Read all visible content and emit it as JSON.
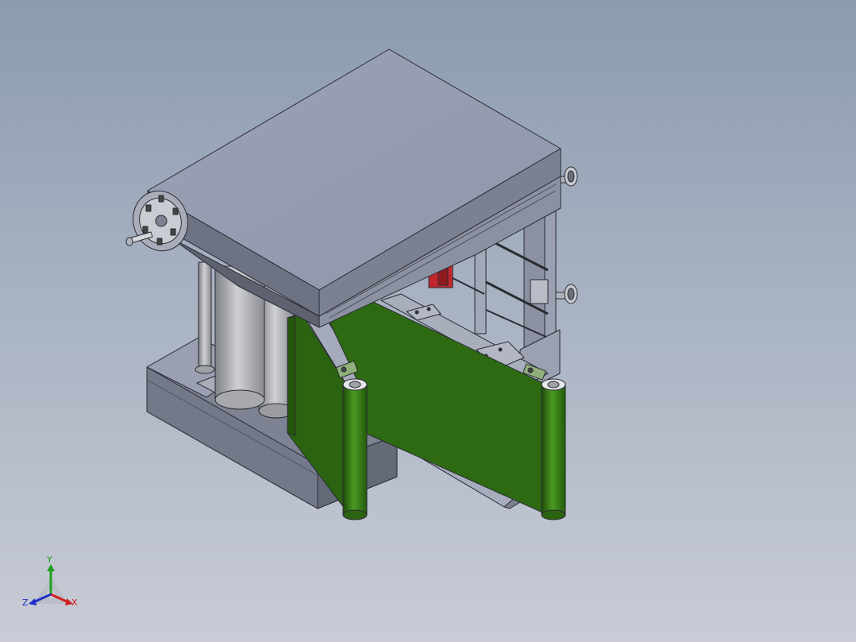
{
  "view": {
    "background_top": "#8c9bb0",
    "background_bottom": "#c8ccd6"
  },
  "model": {
    "body_color": "#9aa0b4",
    "body_dark": "#6e7384",
    "panel_color": "#2e6b12",
    "roller_color": "#3f8a1a",
    "accent_red": "#c0272d"
  },
  "triad": {
    "x_label": "X",
    "y_label": "Y",
    "z_label": "Z",
    "x_color": "#d02020",
    "y_color": "#1fa01f",
    "z_color": "#2030c8"
  }
}
